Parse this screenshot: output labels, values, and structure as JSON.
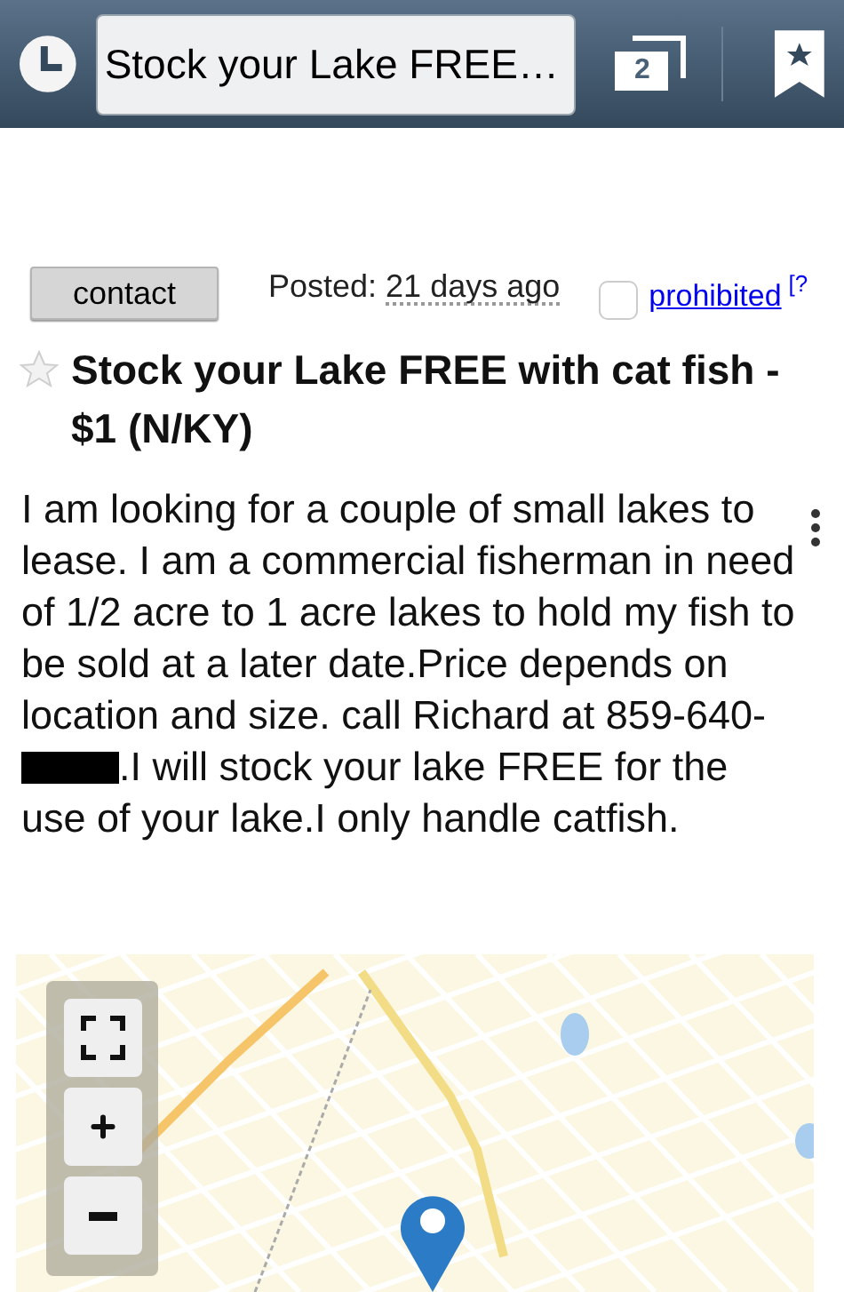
{
  "browser_bar": {
    "address": "Stock your Lake FREE…",
    "tab_count": "2"
  },
  "posting": {
    "contact_button": "contact",
    "posted_label": "Posted:",
    "posted_time": "21 days ago",
    "flag_checked": false,
    "flag_link": "prohibited",
    "help_mark": "[?",
    "starred": false,
    "title": "Stock your Lake FREE with cat fish - $1 (N/KY)"
  },
  "body": {
    "text_before": "I am looking for a couple of small lakes to lease. I am a commercial fisherman in need of 1/2 acre to 1 acre lakes to hold my fish to be sold at a later date.Price depends on location and size. call Richard at 859-640-",
    "redacted": true,
    "text_after": ".I will stock your lake FREE for the use of your lake.I only handle catfish."
  }
}
